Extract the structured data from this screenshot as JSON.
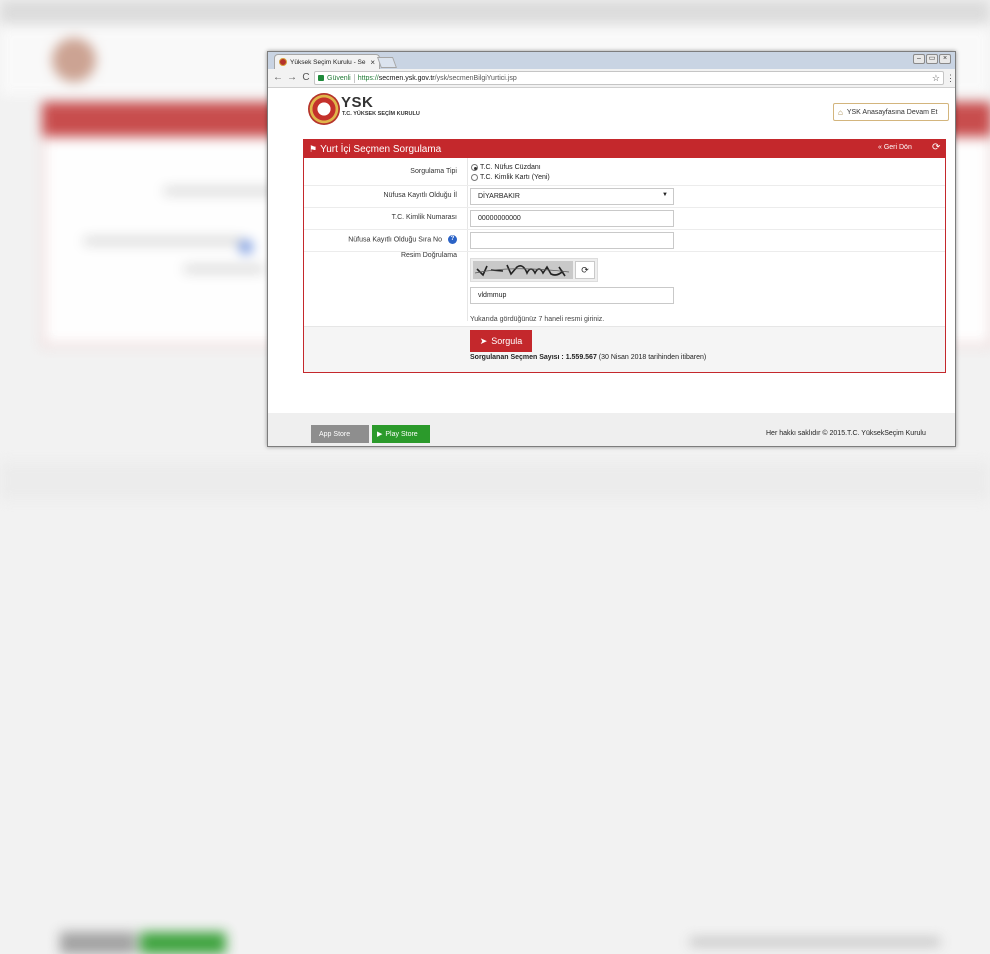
{
  "browser": {
    "tab_title": "Yüksek Seçim Kurulu - Se",
    "tab_close": "×",
    "secure_label": "Güvenli",
    "url_scheme": "https://",
    "url_domain": "secmen.ysk.gov.tr",
    "url_path": "/ysk/secmenBilgiYurtici.jsp",
    "star": "☆",
    "menu": "⋮",
    "back": "←",
    "forward": "→",
    "reload": "C",
    "win_min": "–",
    "win_restore": "▭",
    "win_close": "×"
  },
  "header": {
    "logo_text": "YSK",
    "logo_subtitle": "T.C. YÜKSEK SEÇİM KURULU",
    "home_button": "YSK Anasayfasına Devam Et",
    "home_icon": "⌂"
  },
  "panel": {
    "title": "Yurt İçi Seçmen Sorgulama",
    "flag_icon": "⚑",
    "back_label": "« Geri Dön",
    "refresh_icon": "⟳",
    "query_type_label": "Sorgulama Tipi",
    "query_types": [
      "T.C. Nüfus Cüzdanı",
      "T.C. Kimlik Kartı (Yeni)"
    ],
    "selected_query_type": 0,
    "province_label": "Nüfusa Kayıtlı Olduğu İl",
    "province_value": "DİYARBAKIR",
    "tc_label": "T.C. Kimlik Numarası",
    "tc_value": "00000000000",
    "sira_label": "Nüfusa Kayıtlı Olduğu Sıra No",
    "sira_value": "",
    "help_icon": "?",
    "captcha_label": "Resim Doğrulama",
    "captcha_value": "vldmmup",
    "captcha_refresh_icon": "⟳",
    "hint": "Yukarıda gördüğünüz 7 haneli resmi giriniz.",
    "submit_label": "Sorgula",
    "submit_icon": "➤",
    "count_label": "Sorgulanan Seçmen Sayısı : 1.559.567",
    "count_note": "(30 Nisan 2018 tarihinden itibaren)"
  },
  "footer": {
    "app_store": "App Store",
    "play_store": "Play Store",
    "copyright": "Her hakkı saklıdır © 2015.T.C. YüksekSeçim Kurulu"
  },
  "colors": {
    "brand_red": "#c4282c",
    "play_green": "#2b9a2b",
    "app_gray": "#8e8e8e"
  }
}
